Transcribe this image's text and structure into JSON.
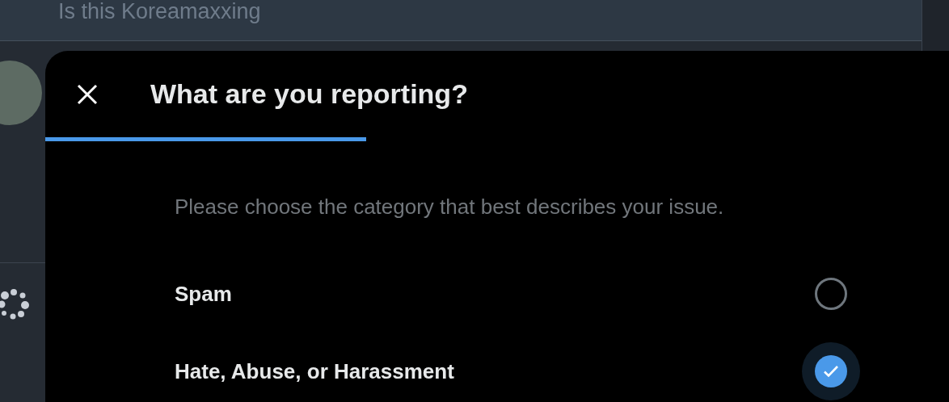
{
  "background_post": {
    "text": "Is this Koreamaxxing"
  },
  "dialog": {
    "title": "What are you reporting?",
    "progress": {
      "level": 0.355
    },
    "description": "Please choose the category that best describes your issue.",
    "options": [
      {
        "label": "Spam",
        "selected": false
      },
      {
        "label": "Hate, Abuse, or Harassment",
        "selected": true
      }
    ]
  }
}
